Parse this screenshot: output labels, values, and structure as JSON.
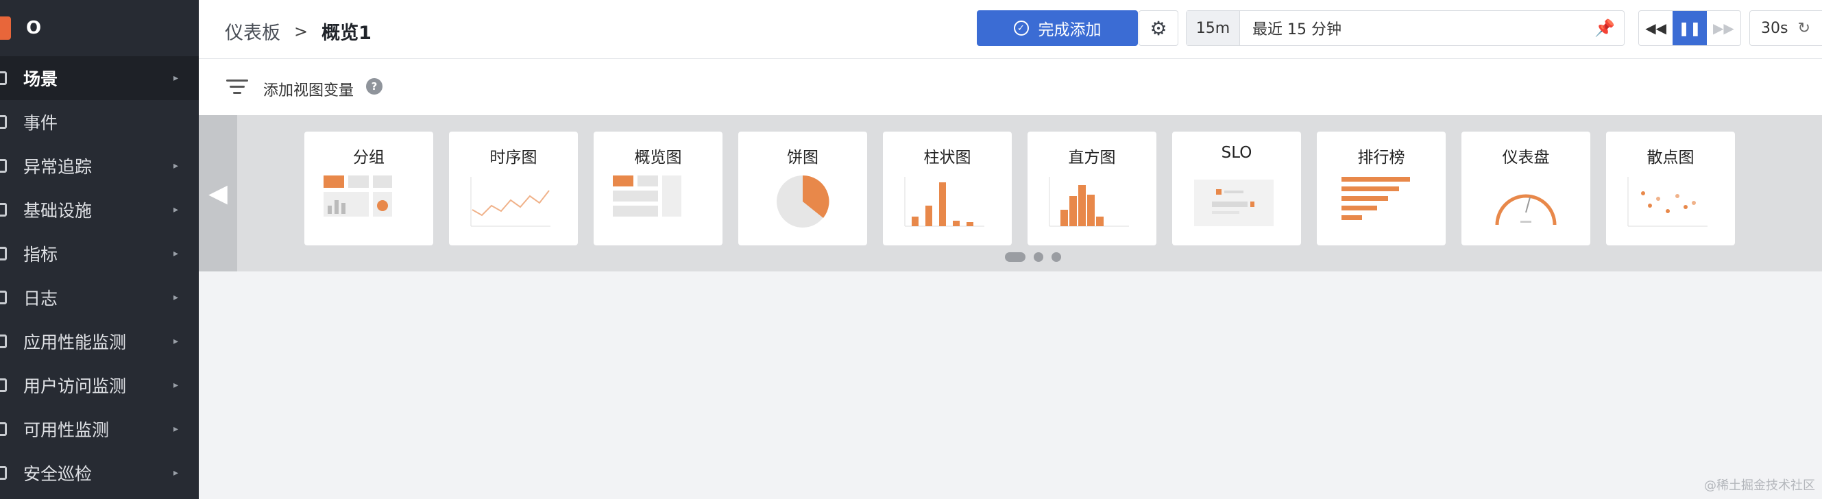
{
  "sidebar": {
    "title": "O",
    "items": [
      {
        "label": "场景",
        "active": true,
        "arrow": true
      },
      {
        "label": "事件",
        "active": false,
        "arrow": false
      },
      {
        "label": "异常追踪",
        "active": false,
        "arrow": true
      },
      {
        "label": "基础设施",
        "active": false,
        "arrow": true
      },
      {
        "label": "指标",
        "active": false,
        "arrow": true
      },
      {
        "label": "日志",
        "active": false,
        "arrow": true
      },
      {
        "label": "应用性能监测",
        "active": false,
        "arrow": true
      },
      {
        "label": "用户访问监测",
        "active": false,
        "arrow": true
      },
      {
        "label": "可用性监测",
        "active": false,
        "arrow": true
      },
      {
        "label": "安全巡检",
        "active": false,
        "arrow": true
      }
    ],
    "arrow_glyph": "▸"
  },
  "header": {
    "breadcrumb_root": "仪表板",
    "breadcrumb_sep": ">",
    "breadcrumb_current": "概览1",
    "done_button": "完成添加",
    "time_short": "15m",
    "time_label": "最近 15 分钟",
    "refresh_interval": "30s"
  },
  "variables": {
    "add_label": "添加视图变量",
    "help_glyph": "?"
  },
  "chart_types": [
    {
      "label": "分组",
      "icon": "group-thumbnail-icon"
    },
    {
      "label": "时序图",
      "icon": "timeseries-thumbnail-icon"
    },
    {
      "label": "概览图",
      "icon": "overview-thumbnail-icon"
    },
    {
      "label": "饼图",
      "icon": "pie-thumbnail-icon"
    },
    {
      "label": "柱状图",
      "icon": "bar-thumbnail-icon"
    },
    {
      "label": "直方图",
      "icon": "histogram-thumbnail-icon"
    },
    {
      "label": "SLO",
      "icon": "slo-thumbnail-icon"
    },
    {
      "label": "排行榜",
      "icon": "toplist-thumbnail-icon"
    },
    {
      "label": "仪表盘",
      "icon": "gauge-thumbnail-icon"
    },
    {
      "label": "散点图",
      "icon": "scatter-thumbnail-icon"
    }
  ],
  "pager": {
    "pages": 3,
    "current": 1
  },
  "watermark": "@稀土掘金技术社区",
  "colors": {
    "accent": "#3b6cd4",
    "orange": "#e8884a",
    "sidebar": "#272b33"
  }
}
